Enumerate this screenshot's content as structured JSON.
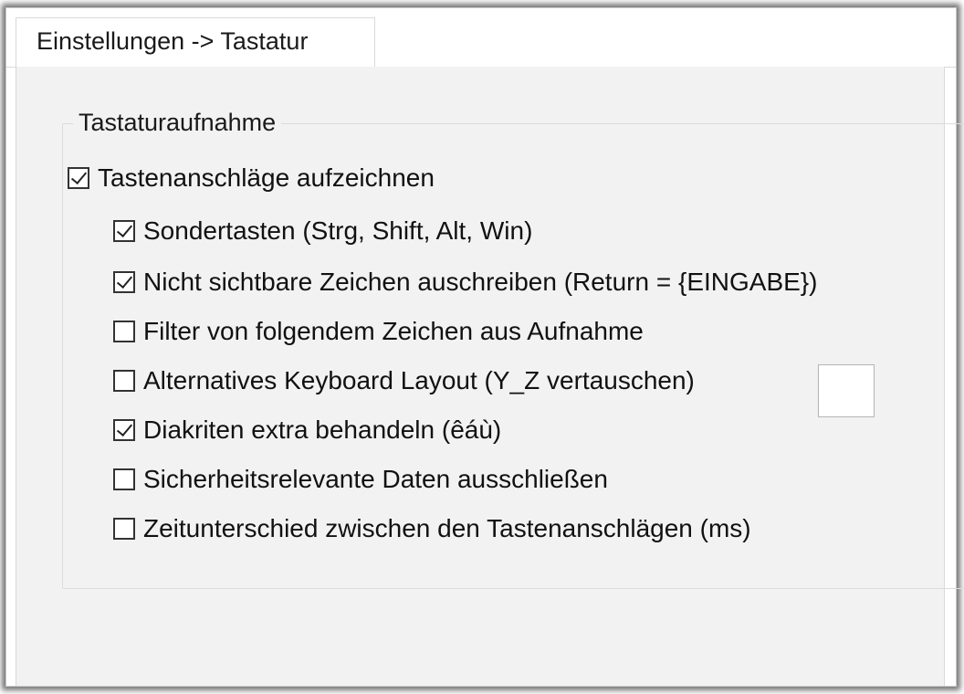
{
  "tab": {
    "label": "Einstellungen -> Tastatur"
  },
  "group": {
    "title": "Tastaturaufnahme"
  },
  "options": [
    {
      "label": "Tastenanschläge aufzeichnen",
      "checked": true
    },
    {
      "label": "Sondertasten (Strg, Shift, Alt, Win)",
      "checked": true
    },
    {
      "label": "Nicht sichtbare Zeichen auschreiben (Return = {EINGABE})",
      "checked": true
    },
    {
      "label": "Filter von folgendem Zeichen aus Aufnahme",
      "checked": false
    },
    {
      "label": "Alternatives Keyboard Layout (Y_Z vertauschen)",
      "checked": false
    },
    {
      "label": "Diakriten extra behandeln (êáù)",
      "checked": true
    },
    {
      "label": "Sicherheitsrelevante Daten ausschließen",
      "checked": false
    },
    {
      "label": "Zeitunterschied zwischen den Tastenanschlägen (ms)",
      "checked": false
    }
  ],
  "filter_char_input": {
    "value": ""
  }
}
